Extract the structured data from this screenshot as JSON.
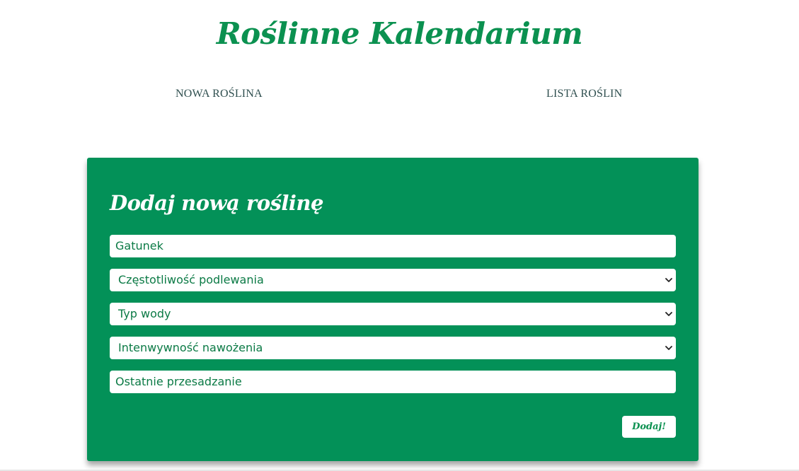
{
  "app": {
    "title": "Roślinne Kalendarium"
  },
  "nav": {
    "new_plant": "NOWA ROŚLINA",
    "plant_list": "LISTA ROŚLIN"
  },
  "form": {
    "heading": "Dodaj nową roślinę",
    "species_placeholder": "Gatunek",
    "watering_frequency_selected": "Częstotliwość podlewania",
    "water_type_selected": "Typ wody",
    "fertilizing_intensity_selected": "Intenwywność nawożenia",
    "last_repotting_placeholder": "Ostatnie przesadzanie",
    "submit_label": "Dodaj!"
  },
  "colors": {
    "brand_green": "#0b9150",
    "card_green": "#039158",
    "nav_text": "#2f4f4f"
  },
  "icons": {
    "select_arrow": "chevron-down-icon"
  }
}
